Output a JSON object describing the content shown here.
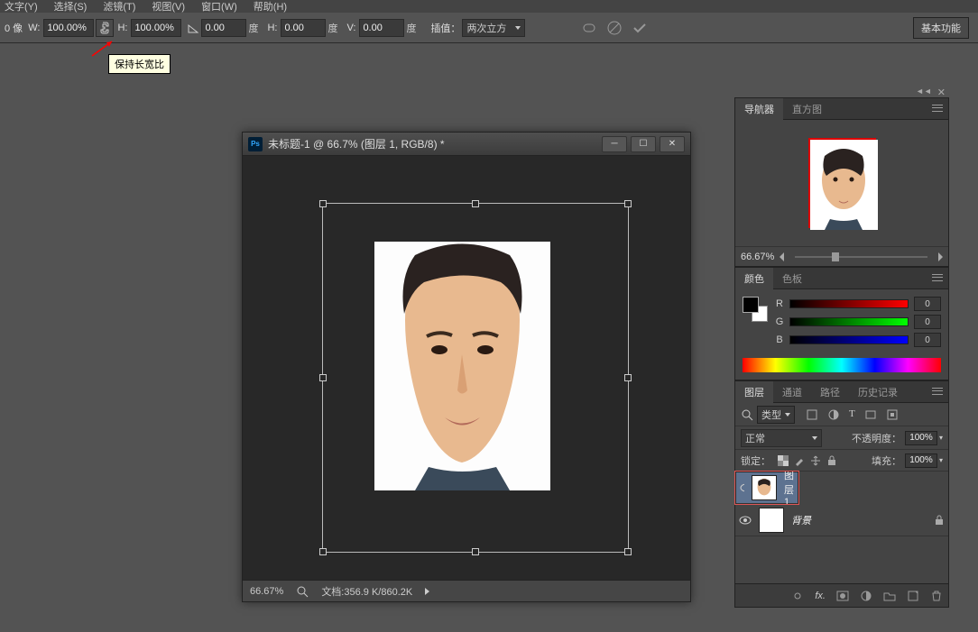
{
  "menu": {
    "items": [
      "文字(Y)",
      "选择(S)",
      "滤镜(T)",
      "视图(V)",
      "窗口(W)",
      "帮助(H)"
    ]
  },
  "options": {
    "pixels_label": "0 像",
    "w_label": "W:",
    "w_value": "100.00%",
    "h_label": "H:",
    "h_value": "100.00%",
    "rotate_value": "0.00",
    "rotate_unit": "度",
    "hskew_label": "H:",
    "hskew_value": "0.00",
    "hskew_unit": "度",
    "vskew_label": "V:",
    "vskew_value": "0.00",
    "vskew_unit": "度",
    "interpolate_label": "插值：",
    "interpolate_value": "两次立方",
    "basic_button": "基本功能"
  },
  "tooltip": "保持长宽比",
  "doc": {
    "title": "未标题-1 @ 66.7% (图层 1, RGB/8) *",
    "zoom": "66.67%",
    "status": "文档:356.9 K/860.2K"
  },
  "navigator": {
    "tab1": "导航器",
    "tab2": "直方图",
    "zoom": "66.67%"
  },
  "color": {
    "tab1": "颜色",
    "tab2": "色板",
    "r": "R",
    "g": "G",
    "b": "B",
    "r_val": "0",
    "g_val": "0",
    "b_val": "0"
  },
  "layers": {
    "tab1": "图层",
    "tab2": "通道",
    "tab3": "路径",
    "tab4": "历史记录",
    "type": "类型",
    "blend": "正常",
    "opacity_label": "不透明度：",
    "opacity": "100%",
    "lock_label": "锁定：",
    "fill_label": "填充：",
    "fill": "100%",
    "items": [
      {
        "name": "图层 1"
      },
      {
        "name": "背景"
      }
    ]
  }
}
